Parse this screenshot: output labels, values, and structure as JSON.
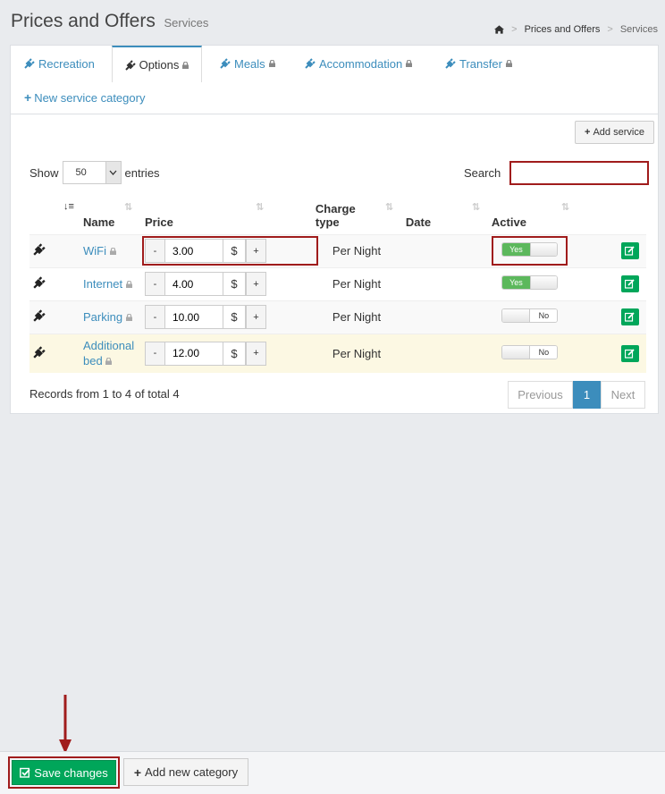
{
  "header": {
    "title": "Prices and Offers",
    "subtitle": "Services"
  },
  "breadcrumb": {
    "home_icon": "home-icon",
    "items": [
      "Prices and Offers",
      "Services"
    ]
  },
  "tabs": [
    {
      "label": "Recreation",
      "locked": false,
      "active": false
    },
    {
      "label": "Options",
      "locked": true,
      "active": true
    },
    {
      "label": "Meals",
      "locked": true,
      "active": false
    },
    {
      "label": "Accommodation",
      "locked": true,
      "active": false
    },
    {
      "label": "Transfer",
      "locked": true,
      "active": false
    }
  ],
  "new_category_link": "New service category",
  "add_service_label": "Add service",
  "length": {
    "show_label": "Show",
    "value": "50",
    "entries_label": "entries"
  },
  "search": {
    "label": "Search",
    "value": ""
  },
  "table": {
    "headers": [
      "Name",
      "Price",
      "Charge type",
      "Date",
      "Active"
    ],
    "rows": [
      {
        "name": "WiFi",
        "locked": true,
        "price": "3.00",
        "currency": "$",
        "charge": "Per Night",
        "date": "",
        "active": "Yes"
      },
      {
        "name": "Internet",
        "locked": true,
        "price": "4.00",
        "currency": "$",
        "charge": "Per Night",
        "date": "",
        "active": "Yes"
      },
      {
        "name": "Parking",
        "locked": true,
        "price": "10.00",
        "currency": "$",
        "charge": "Per Night",
        "date": "",
        "active": "No"
      },
      {
        "name": "Additional bed",
        "locked": true,
        "price": "12.00",
        "currency": "$",
        "charge": "Per Night",
        "date": "",
        "active": "No"
      }
    ],
    "minus_label": "-",
    "plus_label": "+"
  },
  "records_text": "Records from 1 to 4 of total 4",
  "pagination": {
    "previous": "Previous",
    "current": "1",
    "next": "Next"
  },
  "footer": {
    "save_label": "Save changes",
    "add_category_label": "Add new category"
  },
  "colors": {
    "accent": "#3c8dbc",
    "success": "#00a65a",
    "highlight": "#a01c1c"
  }
}
